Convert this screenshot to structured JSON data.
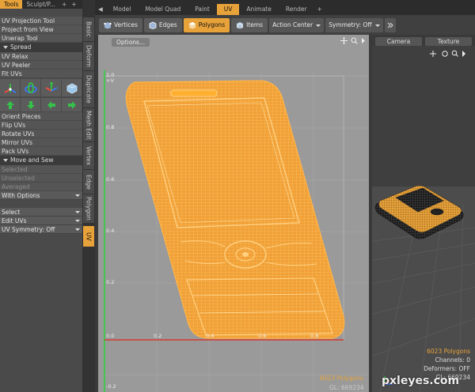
{
  "left_tabs": [
    "Tools",
    "Sculpt/P...",
    "+",
    "+"
  ],
  "groups": {
    "projection": [
      "UV Projection Tool",
      "Project from View",
      "Unwrap Tool"
    ],
    "spread_header": "Spread",
    "relax": [
      "UV Relax",
      "UV Peeler",
      "Fit UVs"
    ],
    "orient": [
      "Orient Pieces",
      "Flip UVs",
      "Rotate UVs",
      "Mirror UVs",
      "Pack UVs"
    ],
    "move_header": "Move and Sew",
    "selection_states": [
      "Selected",
      "Unselected",
      "Averaged"
    ],
    "with_options": "With Options",
    "select": "Select",
    "edit_uvs": "Edit UVs",
    "uv_symmetry": "UV Symmetry: Off"
  },
  "vertical_tabs": [
    "Basic",
    "Deform",
    "Duplicate",
    "Mesh Edit",
    "Vertex",
    "Edge",
    "Polygon",
    "UV"
  ],
  "layout_tabs": [
    "Model",
    "Model Quad",
    "Paint",
    "UV",
    "Animate",
    "Render",
    "+"
  ],
  "toolbar": {
    "vertices": "Vertices",
    "edges": "Edges",
    "polygons": "Polygons",
    "items": "Items",
    "action_center": "Action Center",
    "symmetry": "Symmetry: Off"
  },
  "uv_view": {
    "options": "Options...",
    "axis_labels_y": [
      "1.0",
      "0.8",
      "0.6",
      "0.4",
      "0.2",
      "0.0",
      "-0.2"
    ],
    "axis_labels_x": [
      "0.2",
      "0.4",
      "0.6",
      "0.8"
    ],
    "v_label": "+V",
    "polygons": "6023 Polygons",
    "gl": "GL: 669234"
  },
  "perspective": {
    "tabs": [
      "Camera",
      "Texture"
    ],
    "polygons": "6023 Polygons",
    "channels": "Channels: 0",
    "deformers": "Deformers: OFF",
    "gl": "GL: 669234"
  },
  "colors": {
    "accent": "#e8a23a",
    "uv_wire": "#ffa82a",
    "panel": "#4a4a4a"
  },
  "watermark": "pxleyes.com"
}
